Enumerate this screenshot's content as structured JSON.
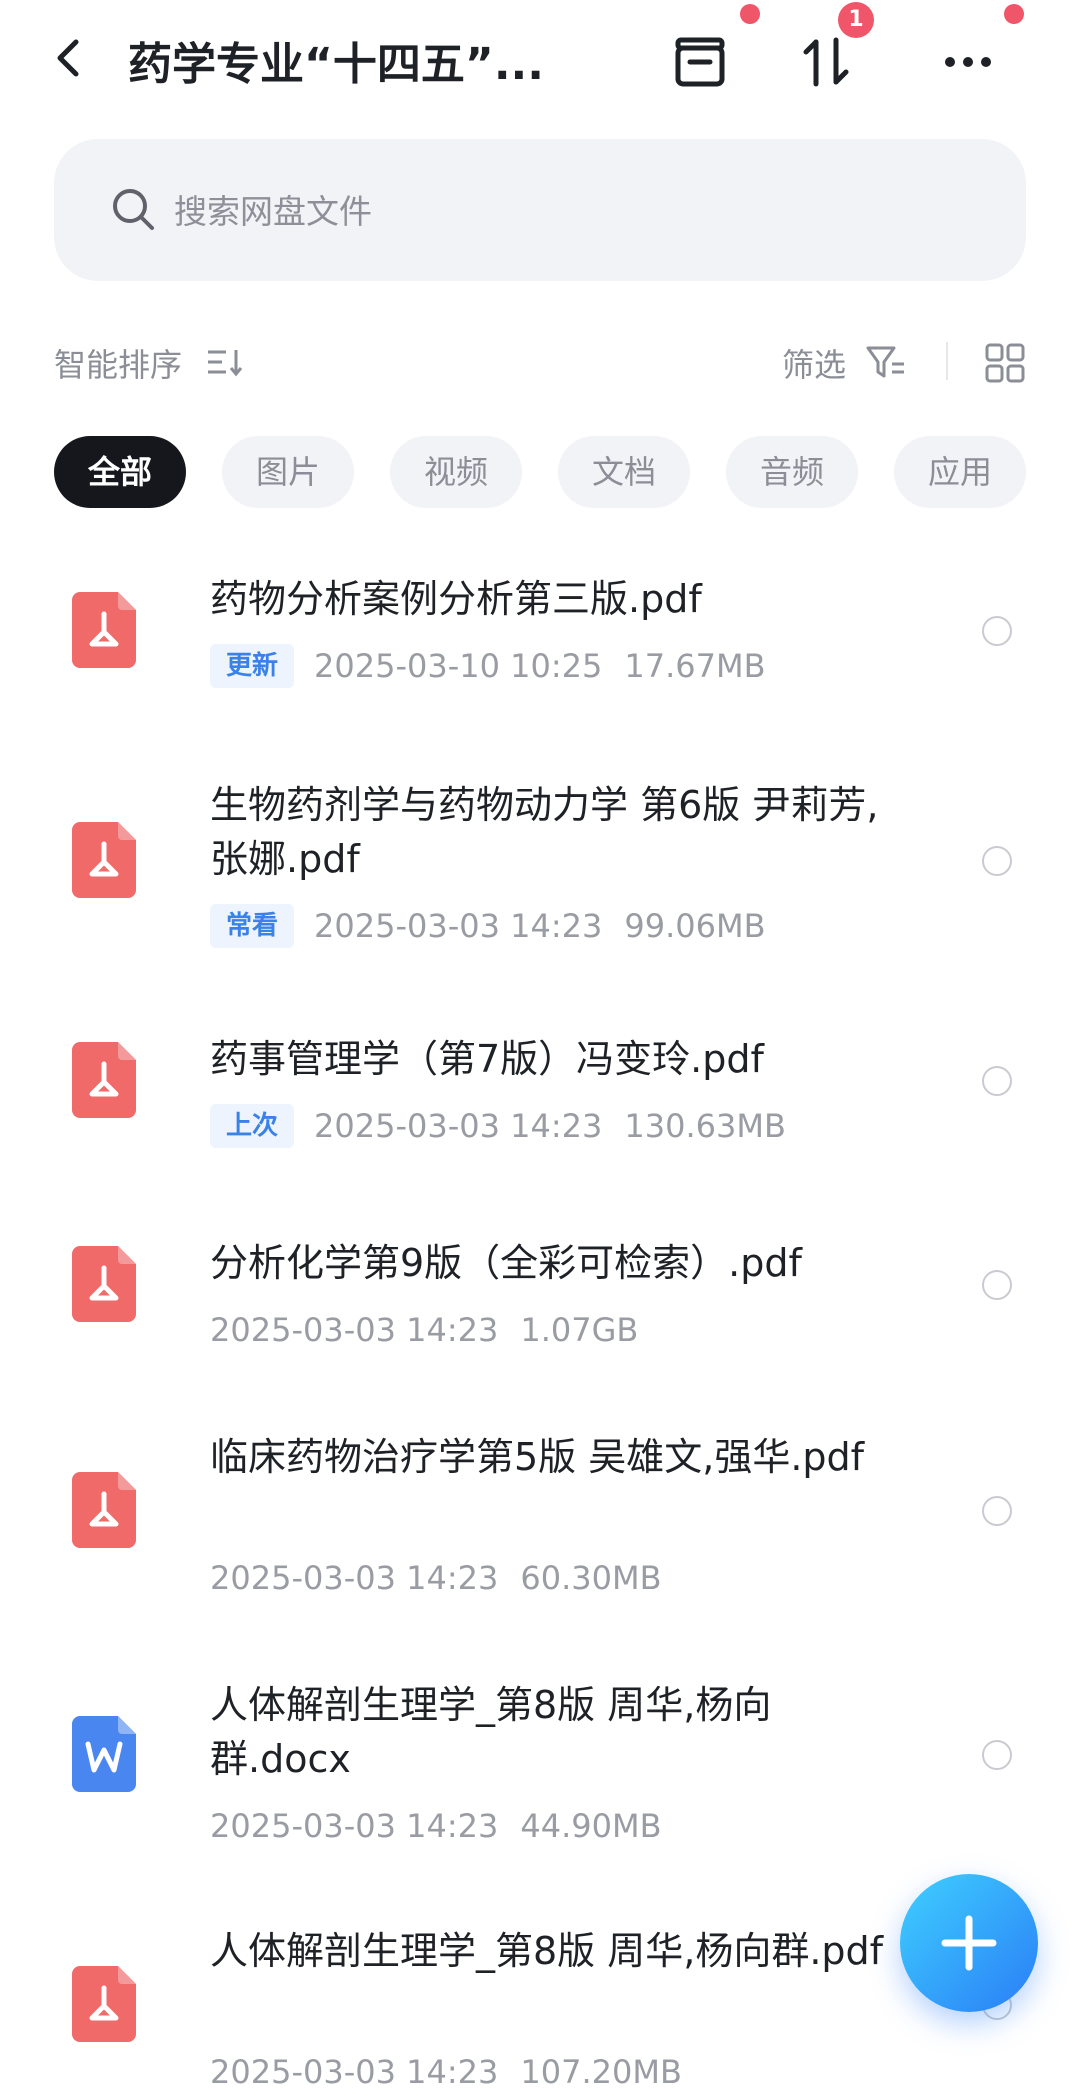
{
  "header": {
    "title": "药学专业“十四五”...",
    "transfer_badge": "1"
  },
  "search": {
    "placeholder": "搜索网盘文件"
  },
  "toolbar": {
    "sort_label": "智能排序",
    "filter_label": "筛选"
  },
  "tabs": [
    {
      "label": "全部",
      "active": true
    },
    {
      "label": "图片"
    },
    {
      "label": "视频"
    },
    {
      "label": "文档"
    },
    {
      "label": "音频"
    },
    {
      "label": "应用"
    }
  ],
  "files": [
    {
      "name": "药物分析案例分析第三版.pdf",
      "tag": "更新",
      "date": "2025-03-10  10:25",
      "size": "17.67MB",
      "type": "pdf"
    },
    {
      "name": "生物药剂学与药物动力学 第6版 尹莉芳,张娜.pdf",
      "tag": "常看",
      "date": "2025-03-03  14:23",
      "size": "99.06MB",
      "type": "pdf"
    },
    {
      "name": "药事管理学（第7版）冯变玲.pdf",
      "tag": "上次",
      "date": "2025-03-03  14:23",
      "size": "130.63MB",
      "type": "pdf"
    },
    {
      "name": "分析化学第9版（全彩可检索）.pdf",
      "tag": "",
      "date": "2025-03-03  14:23",
      "size": "1.07GB",
      "type": "pdf"
    },
    {
      "name": "临床药物治疗学第5版 吴雄文,强华.pdf",
      "tag": "",
      "date": "2025-03-03  14:23",
      "size": "60.30MB",
      "type": "pdf"
    },
    {
      "name": "人体解剖生理学_第8版 周华,杨向群.docx",
      "tag": "",
      "date": "2025-03-03  14:23",
      "size": "44.90MB",
      "type": "docx"
    },
    {
      "name": "人体解剖生理学_第8版 周华,杨向群.pdf",
      "tag": "",
      "date": "2025-03-03  14:23",
      "size": "107.20MB",
      "type": "pdf"
    }
  ],
  "colors": {
    "pdf": "#f06a6a",
    "docx": "#4a86f0",
    "accent": "#3b82e8",
    "badge": "#f0566a"
  }
}
